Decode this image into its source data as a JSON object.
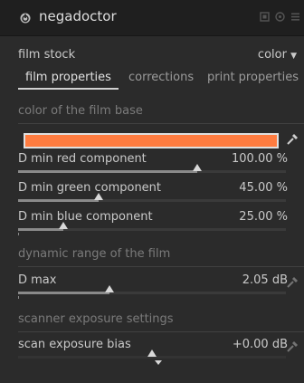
{
  "module": {
    "title": "negadoctor"
  },
  "film_stock": {
    "label": "film stock",
    "value": "color"
  },
  "tabs": [
    {
      "label": "film properties",
      "active": true
    },
    {
      "label": "corrections",
      "active": false
    },
    {
      "label": "print properties",
      "active": false
    }
  ],
  "sections": {
    "film_base": "color of the film base",
    "dynamic_range": "dynamic range of the film",
    "scanner": "scanner exposure settings"
  },
  "film_base_color": "#ff7c40",
  "sliders": [
    {
      "label": "D min red component",
      "value": "100.00 %",
      "fraction": 0.67
    },
    {
      "label": "D min green component",
      "value": "45.00 %",
      "fraction": 0.3
    },
    {
      "label": "D min blue component",
      "value": "25.00 %",
      "fraction": 0.17
    },
    {
      "label": "D max",
      "value": "2.05 dB",
      "fraction": 0.34
    },
    {
      "label": "scan exposure bias",
      "value": "+0.00 dB",
      "fraction": 0.5
    }
  ],
  "icons": [
    "power-icon",
    "presets-icon",
    "reset-icon",
    "menu-icon",
    "color-picker-icon"
  ]
}
